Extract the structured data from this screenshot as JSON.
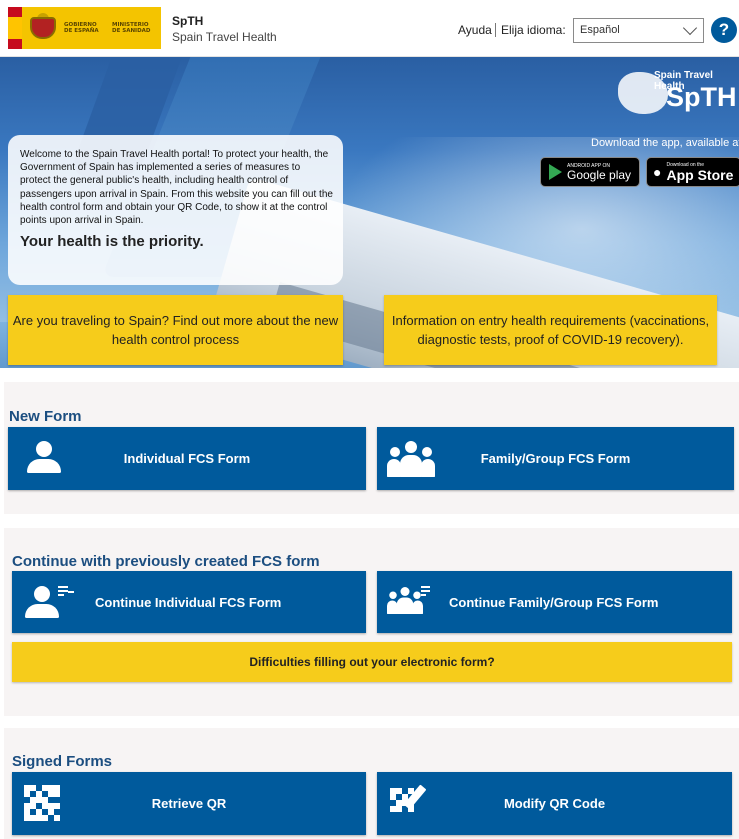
{
  "header": {
    "gov_line1": "GOBIERNO DE ESPAÑA",
    "gov_line2": "MINISTERIO DE SANIDAD",
    "app_short": "SpTH",
    "app_full": "Spain Travel Health",
    "help_label": "Ayuda",
    "language_label": "Elija idioma:",
    "language_value": "Español",
    "help_icon_glyph": "?"
  },
  "hero": {
    "brand_top": "Spain Travel Health",
    "brand": "SpTH",
    "download_text": "Download the app, available at",
    "google_small": "ANDROID APP ON",
    "google_big": "Google play",
    "apple_small": "Download on the",
    "apple_big": "App Store",
    "welcome_text": "Welcome to the Spain Travel Health portal! To protect your health, the Government of Spain has implemented a series of measures to protect the general public's health, including health control of passengers upon arrival in Spain. From this website you can fill out the health control form and obtain your QR Code, to show it at the control points upon arrival in Spain.",
    "motto": "Your health is the priority.",
    "card_travel": "Are you traveling to Spain? Find out more about the new health control process",
    "card_info": "Information on entry health requirements (vaccinations, diagnostic tests, proof of COVID-19 recovery)."
  },
  "new_form": {
    "title": "New Form",
    "individual": "Individual FCS Form",
    "family": "Family/Group FCS Form"
  },
  "continue": {
    "title": "Continue with previously created FCS form",
    "individual": "Continue Individual FCS Form",
    "family": "Continue Family/Group FCS Form",
    "difficulties": "Difficulties filling out your electronic form?"
  },
  "signed": {
    "title": "Signed Forms",
    "retrieve": "Retrieve QR",
    "modify": "Modify QR Code"
  },
  "colors": {
    "primary_blue": "#005a9c",
    "accent_yellow": "#f6cc1b",
    "section_title": "#1c4e80",
    "panel_bg": "#f7f4f4"
  },
  "icons": [
    "shield-flag-icon",
    "help-icon",
    "chevron-down-icon",
    "google-play-icon",
    "apple-icon",
    "person-icon",
    "group-icon",
    "person-add-icon",
    "group-add-icon",
    "qr-code-icon",
    "qr-edit-icon"
  ]
}
